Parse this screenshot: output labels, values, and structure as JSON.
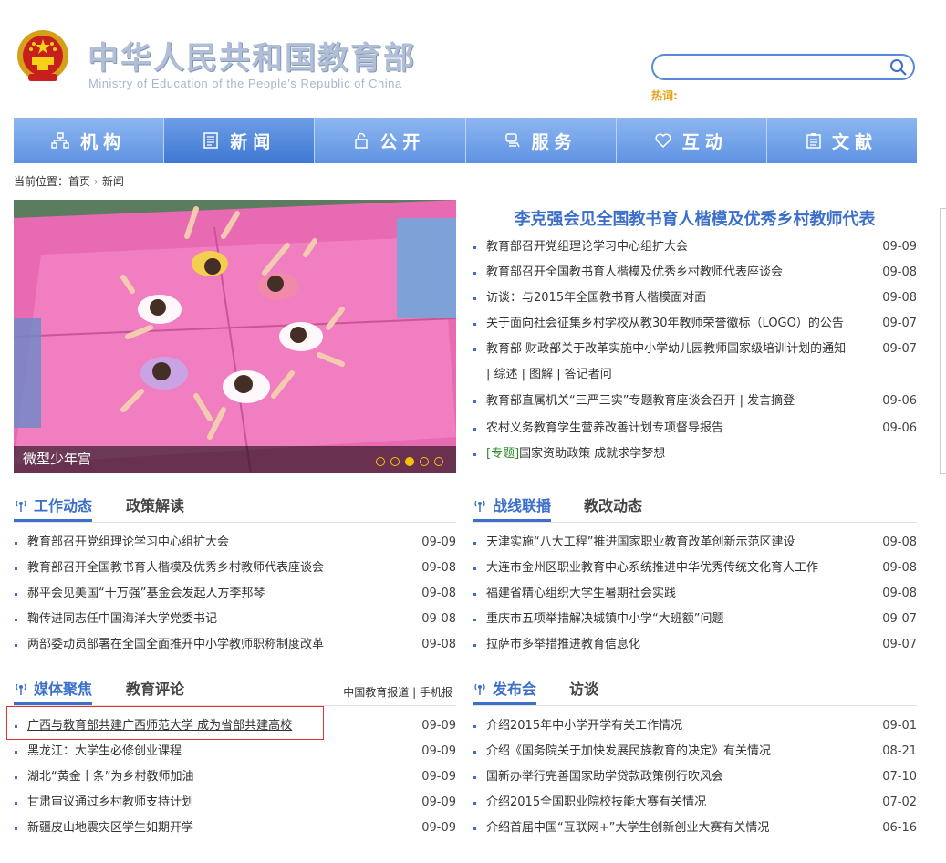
{
  "header": {
    "title": "中华人民共和国教育部",
    "subtitle": "Ministry of Education of the People's Republic of China",
    "search_placeholder": "",
    "hot_words_label": "热词:"
  },
  "nav": [
    {
      "label": "机构",
      "icon": "org-chart-icon",
      "active": false
    },
    {
      "label": "新闻",
      "icon": "newspaper-icon",
      "active": true
    },
    {
      "label": "公开",
      "icon": "lock-icon",
      "active": false
    },
    {
      "label": "服务",
      "icon": "service-icon",
      "active": false
    },
    {
      "label": "互动",
      "icon": "heart-icon",
      "active": false
    },
    {
      "label": "文献",
      "icon": "document-icon",
      "active": false
    }
  ],
  "breadcrumb": {
    "prefix": "当前位置：",
    "home": "首页",
    "current": "新闻"
  },
  "slideshow": {
    "caption": "微型少年宫",
    "dots": 5,
    "active_dot": 3
  },
  "headline": {
    "title": "李克强会见全国教书育人楷模及优秀乡村教师代表",
    "items": [
      {
        "text": "教育部召开党组理论学习中心组扩大会",
        "date": "09-09"
      },
      {
        "text": "教育部召开全国教书育人楷模及优秀乡村教师代表座谈会",
        "date": "09-08"
      },
      {
        "text": "访谈：与2015年全国教书育人楷模面对面",
        "date": "09-08"
      },
      {
        "text": "关于面向社会征集乡村学校从教30年教师荣誉徽标（LOGO）的公告",
        "date": "09-07"
      },
      {
        "text": "教育部 财政部关于改革实施中小学幼儿园教师国家级培训计划的通知",
        "date": "09-07"
      },
      {
        "text": "| 综述 | 图解 | 答记者问",
        "date": ""
      },
      {
        "text": "教育部直属机关“三严三实”专题教育座谈会召开",
        "extra": " | 发言摘登",
        "date": "09-06"
      },
      {
        "text": "农村义务教育学生营养改善计划专项督导报告",
        "date": "09-06"
      },
      {
        "tag": "[专题]",
        "text": "国家资助政策 成就求学梦想",
        "date": ""
      }
    ]
  },
  "work": {
    "tabs": [
      "工作动态",
      "政策解读"
    ],
    "items": [
      {
        "text": "教育部召开党组理论学习中心组扩大会",
        "date": "09-09"
      },
      {
        "text": "教育部召开全国教书育人楷模及优秀乡村教师代表座谈会",
        "date": "09-08"
      },
      {
        "text": "郝平会见美国“十万强”基金会发起人方李邦琴",
        "date": "09-08"
      },
      {
        "text": "鞠传进同志任中国海洋大学党委书记",
        "date": "09-08"
      },
      {
        "text": "两部委动员部署在全国全面推开中小学教师职称制度改革",
        "date": "09-08"
      }
    ]
  },
  "front": {
    "tabs": [
      "战线联播",
      "教改动态"
    ],
    "items": [
      {
        "text": "天津实施“八大工程”推进国家职业教育改革创新示范区建设",
        "date": "09-08"
      },
      {
        "text": "大连市金州区职业教育中心系统推进中华优秀传统文化育人工作",
        "date": "09-08"
      },
      {
        "text": "福建省精心组织大学生暑期社会实践",
        "date": "09-08"
      },
      {
        "text": "重庆市五项举措解决城镇中小学“大班额”问题",
        "date": "09-07"
      },
      {
        "text": "拉萨市多举措推进教育信息化",
        "date": "09-07"
      }
    ]
  },
  "media": {
    "tabs": [
      "媒体聚焦",
      "教育评论"
    ],
    "links": [
      "中国教育报道",
      "手机报"
    ],
    "items": [
      {
        "text": "广西与教育部共建广西师范大学 成为省部共建高校",
        "date": "09-09"
      },
      {
        "text": "黑龙江：大学生必修创业课程",
        "date": "09-09"
      },
      {
        "text": "湖北“黄金十条”为乡村教师加油",
        "date": "09-09"
      },
      {
        "text": "甘肃审议通过乡村教师支持计划",
        "date": "09-09"
      },
      {
        "text": "新疆皮山地震灾区学生如期开学",
        "date": "09-09"
      }
    ]
  },
  "release": {
    "tabs": [
      "发布会",
      "访谈"
    ],
    "items": [
      {
        "text": "介绍2015年中小学开学有关工作情况",
        "date": "09-01"
      },
      {
        "text": "介绍《国务院关于加快发展民族教育的决定》有关情况",
        "date": "08-21"
      },
      {
        "text": "国新办举行完善国家助学贷款政策例行吹风会",
        "date": "07-10"
      },
      {
        "text": "介绍2015全国职业院校技能大赛有关情况",
        "date": "07-02"
      },
      {
        "text": "介绍首届中国“互联网+”大学生创新创业大赛有关情况",
        "date": "06-16"
      }
    ]
  },
  "colors": {
    "brand": "#3b6fc9",
    "nav_top": "#8eb7f0",
    "nav_bottom": "#5e92e2",
    "hot": "#e8a21c"
  }
}
